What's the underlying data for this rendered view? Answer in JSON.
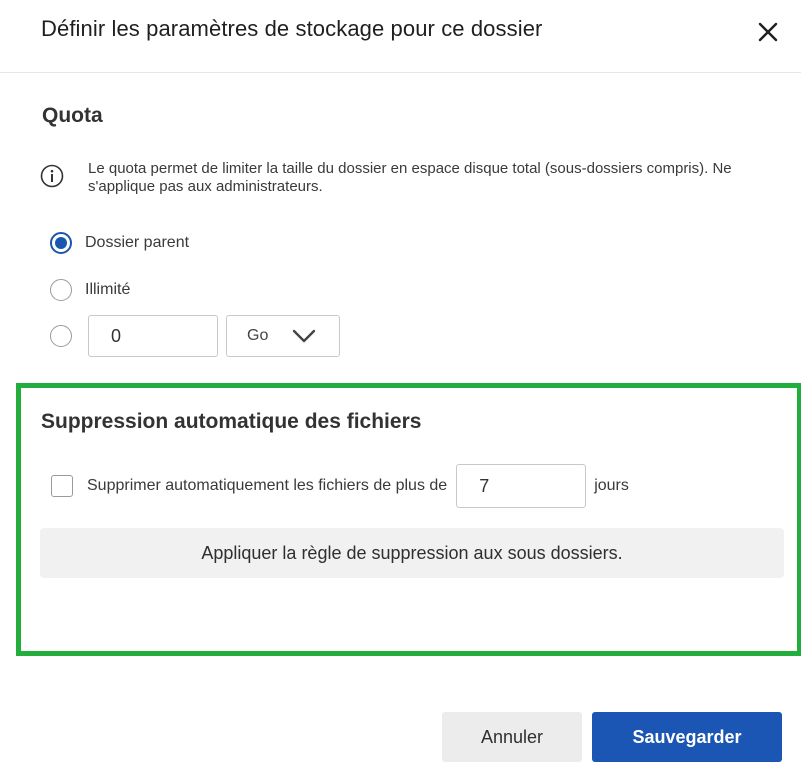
{
  "dialog": {
    "title": "Définir les paramètres de stockage pour ce dossier",
    "close_icon": "close-icon"
  },
  "quota": {
    "title": "Quota",
    "info_icon": "info-icon",
    "info_text": "Le quota permet de limiter la taille du dossier en espace disque total (sous-dossiers compris). Ne s'applique pas aux administrateurs.",
    "options": [
      {
        "label": "Dossier parent",
        "selected": true
      },
      {
        "label": "Illimité",
        "selected": false
      },
      {
        "label": "",
        "selected": false
      }
    ],
    "custom_value": "0",
    "unit": "Go"
  },
  "auto_delete": {
    "title": "Suppression automatique des fichiers",
    "checkbox_label": "Supprimer automatiquement les fichiers de plus de",
    "checked": false,
    "days_value": "7",
    "days_unit": "jours",
    "apply_label": "Appliquer la règle de suppression aux sous dossiers."
  },
  "footer": {
    "cancel_label": "Annuler",
    "save_label": "Sauvegarder"
  },
  "colors": {
    "accent": "#1b56b4",
    "highlight": "#22ad3d"
  }
}
